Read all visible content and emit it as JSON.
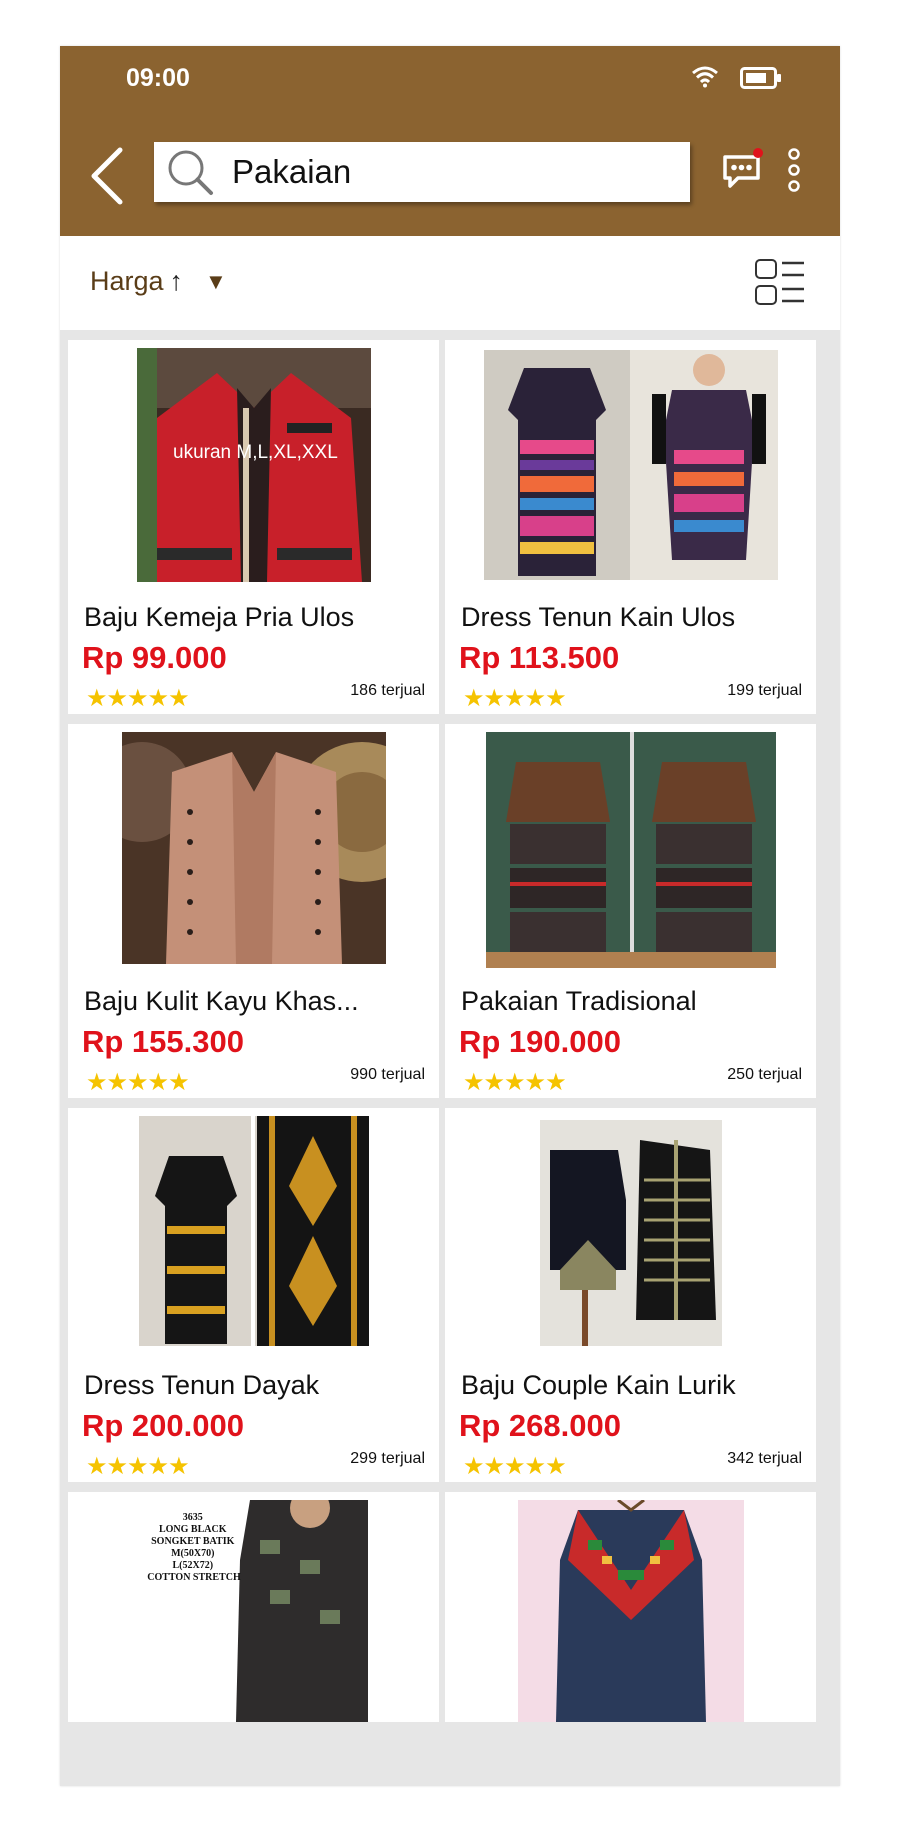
{
  "status_bar": {
    "time": "09:00"
  },
  "header": {
    "search": {
      "value": "Pakaian"
    }
  },
  "filter": {
    "sort_label": "Harga",
    "sort_direction": "↑",
    "caret": "▼"
  },
  "products": [
    {
      "title": "Baju Kemeja Pria Ulos",
      "price": "Rp 99.000",
      "rating": "★★★★★",
      "sold": "186 terjual",
      "image_text": "ukuran M,L,XL,XXL"
    },
    {
      "title": "Dress Tenun Kain Ulos",
      "price": "Rp 113.500",
      "rating": "★★★★★",
      "sold": "199 terjual"
    },
    {
      "title": "Baju Kulit Kayu Khas...",
      "price": "Rp 155.300",
      "rating": "★★★★★",
      "sold": "990 terjual"
    },
    {
      "title": "Pakaian Tradisional",
      "price": "Rp 190.000",
      "rating": "★★★★★",
      "sold": "250 terjual"
    },
    {
      "title": "Dress Tenun Dayak",
      "price": "Rp 200.000",
      "rating": "★★★★★",
      "sold": "299 terjual"
    },
    {
      "title": "Baju Couple Kain Lurik",
      "price": "Rp 268.000",
      "rating": "★★★★★",
      "sold": "342 terjual"
    }
  ],
  "partial_products": [
    {
      "image_text": [
        "3635",
        "LONG BLACK",
        "SONGKET BATIK",
        "M(50X70)",
        "L(52X72)",
        "COTTON STRETCH"
      ]
    },
    {}
  ],
  "colors": {
    "header_bg": "#8b6330",
    "price": "#e0121b",
    "star": "#f5c300",
    "notification_dot": "#e0121b"
  },
  "icons": [
    "back-arrow-icon",
    "search-icon",
    "chat-icon",
    "more-vertical-icon",
    "wifi-icon",
    "battery-icon",
    "list-view-icon",
    "star-icon"
  ]
}
